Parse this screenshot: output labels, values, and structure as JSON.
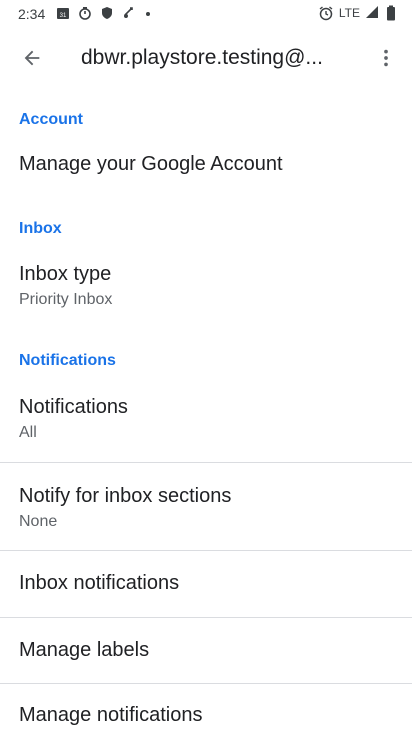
{
  "status_bar": {
    "time": "2:34",
    "network": "LTE",
    "icons_left": [
      "calendar-icon",
      "timer-icon",
      "shield-icon",
      "sync-icon",
      "dot-icon"
    ],
    "icons_right": [
      "alarm-icon",
      "network-label",
      "signal-icon",
      "battery-icon"
    ]
  },
  "app_bar": {
    "title": "dbwr.playstore.testing@...",
    "back_icon": "arrow-back-icon",
    "more_icon": "more-vert-icon"
  },
  "sections": {
    "account": {
      "header": "Account",
      "manage_account": "Manage your Google Account"
    },
    "inbox": {
      "header": "Inbox",
      "inbox_type_title": "Inbox type",
      "inbox_type_value": "Priority Inbox"
    },
    "notifications": {
      "header": "Notifications",
      "notifications_title": "Notifications",
      "notifications_value": "All",
      "notify_sections_title": "Notify for inbox sections",
      "notify_sections_value": "None",
      "inbox_notifications": "Inbox notifications",
      "manage_labels": "Manage labels",
      "manage_notifications": "Manage notifications"
    }
  },
  "colors": {
    "accent": "#1a73e8",
    "text_primary": "#202124",
    "text_secondary": "#5f6368",
    "divider": "#dadce0"
  }
}
